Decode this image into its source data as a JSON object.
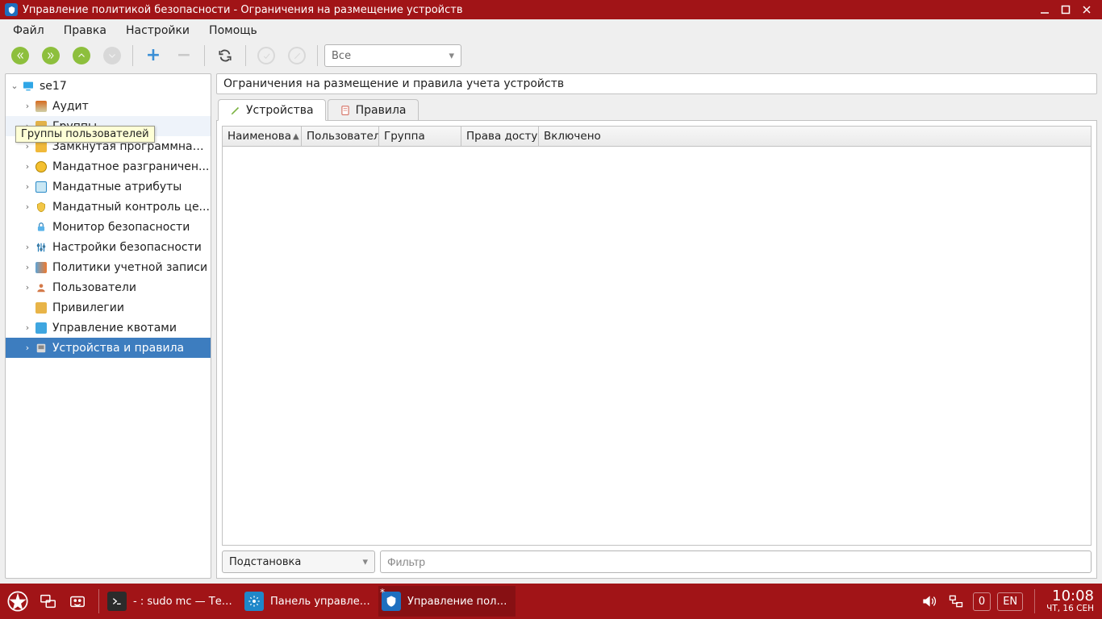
{
  "window": {
    "title": "Управление политикой безопасности - Ограничения на размещение устройств"
  },
  "menu": {
    "file": "Файл",
    "edit": "Правка",
    "settings": "Настройки",
    "help": "Помощь"
  },
  "toolbar": {
    "filter_combo": "Все"
  },
  "tree": {
    "root": "se17",
    "tooltip": "Группы пользователей",
    "items": [
      {
        "label": "Аудит"
      },
      {
        "label": "Группы"
      },
      {
        "label": "Замкнутая программная ..."
      },
      {
        "label": "Мандатное разграничен..."
      },
      {
        "label": "Мандатные атрибуты"
      },
      {
        "label": "Мандатный контроль це..."
      },
      {
        "label": "Монитор безопасности"
      },
      {
        "label": "Настройки безопасности"
      },
      {
        "label": "Политики учетной записи"
      },
      {
        "label": "Пользователи"
      },
      {
        "label": "Привилегии"
      },
      {
        "label": "Управление квотами"
      },
      {
        "label": "Устройства и правила"
      }
    ]
  },
  "main": {
    "heading": "Ограничения на размещение и правила учета устройств",
    "tabs": {
      "devices": "Устройства",
      "rules": "Правила"
    },
    "columns": {
      "name": "Наименова",
      "user": "Пользовател",
      "group": "Группа",
      "access": "Права досту",
      "enabled": "Включено"
    },
    "substitute": "Подстановка",
    "filter_placeholder": "Фильтр"
  },
  "taskbar": {
    "task_term": "- : sudo mc — Тер...",
    "task_panel": "Панель управлен...",
    "task_app": "Управление поли...",
    "count": "0",
    "lang": "EN",
    "time": "10:08",
    "date": "ЧТ, 16 СЕН"
  }
}
